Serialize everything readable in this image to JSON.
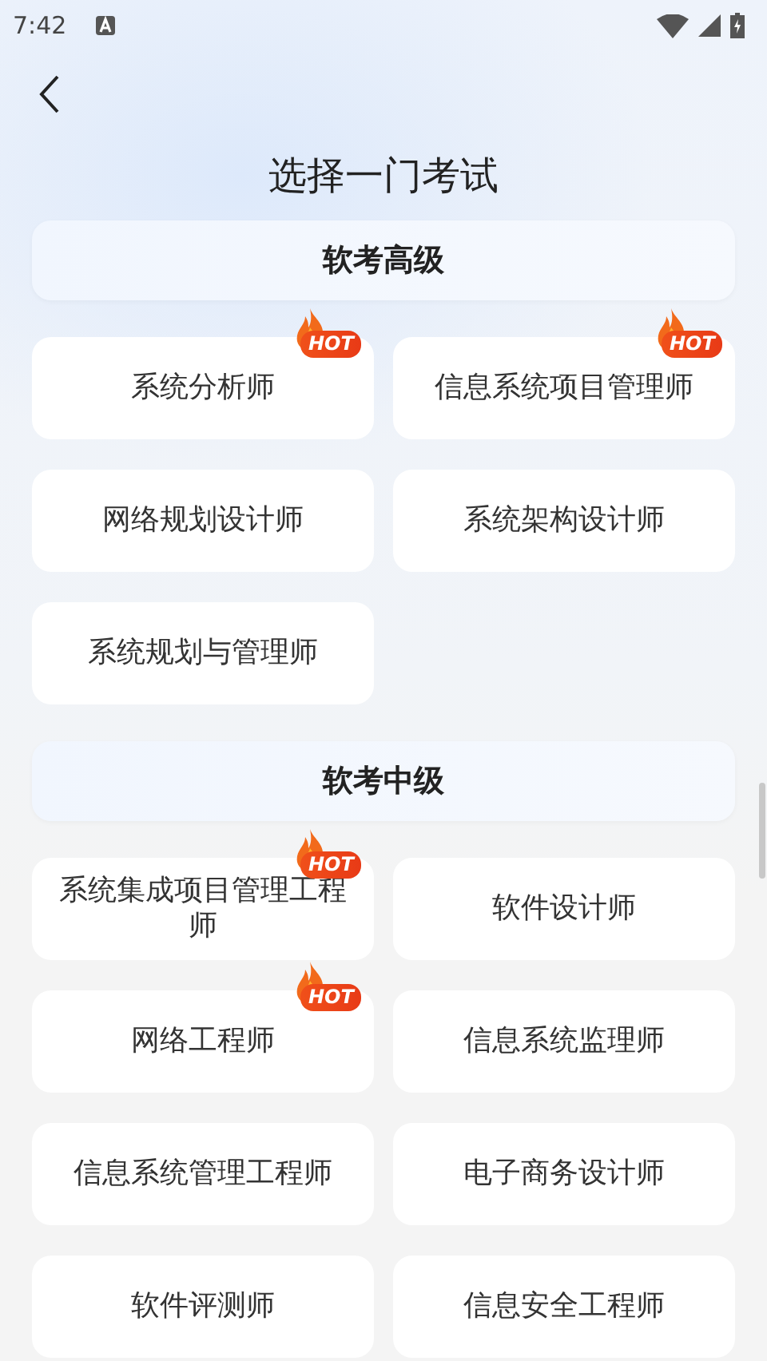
{
  "status_bar": {
    "time": "7:42"
  },
  "title": "选择一门考试",
  "sections": [
    {
      "header": "软考高级",
      "items": [
        {
          "label": "系统分析师",
          "badge": "HOT"
        },
        {
          "label": "信息系统项目管理师",
          "badge": "HOT"
        },
        {
          "label": "网络规划设计师"
        },
        {
          "label": "系统架构设计师"
        },
        {
          "label": "系统规划与管理师"
        }
      ]
    },
    {
      "header": "软考中级",
      "items": [
        {
          "label": "系统集成项目管理工程师",
          "badge": "HOT"
        },
        {
          "label": "软件设计师"
        },
        {
          "label": "网络工程师",
          "badge": "HOT"
        },
        {
          "label": "信息系统监理师"
        },
        {
          "label": "信息系统管理工程师"
        },
        {
          "label": "电子商务设计师"
        },
        {
          "label": "软件评测师"
        },
        {
          "label": "信息安全工程师"
        }
      ]
    }
  ]
}
